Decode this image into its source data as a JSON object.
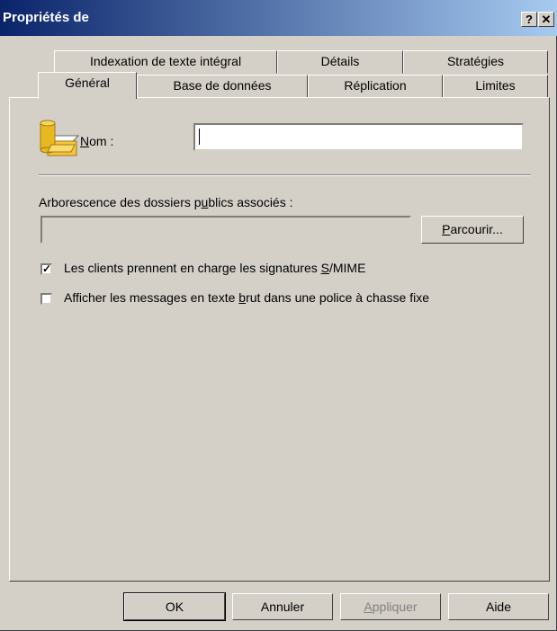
{
  "window": {
    "title": "Propriétés de"
  },
  "titlebar": {
    "help_glyph": "?",
    "close_glyph": "✕"
  },
  "tabs": {
    "row_back": [
      {
        "label": "Indexation de texte intégral"
      },
      {
        "label": "Détails"
      },
      {
        "label": "Stratégies"
      }
    ],
    "row_front": [
      {
        "label": "Général",
        "active": true
      },
      {
        "label": "Base de données"
      },
      {
        "label": "Réplication"
      },
      {
        "label": "Limites"
      }
    ]
  },
  "general": {
    "icon": "database-folder-icon",
    "name_label_mnemonic": "N",
    "name_label_rest": "om :",
    "name_value": "",
    "tree_label_pre": "Arborescence des dossiers p",
    "tree_label_mnemonic": "u",
    "tree_label_post": "blics associés :",
    "tree_value": "",
    "browse_mnemonic": "P",
    "browse_rest": "arcourir...",
    "check1": {
      "checked": true,
      "pre": "Les clients prennent en charge les signatures ",
      "mnemonic": "S",
      "post": "/MIME"
    },
    "check2": {
      "checked": false,
      "pre": "Afficher les messages en texte ",
      "mnemonic": "b",
      "post": "rut dans une police à chasse fixe"
    }
  },
  "footer": {
    "ok": "OK",
    "cancel": "Annuler",
    "apply_mnemonic": "A",
    "apply_rest": "ppliquer",
    "help": "Aide"
  },
  "colors": {
    "dialog_bg": "#d4d0c8",
    "title_start": "#0a246a",
    "title_end": "#a6caf0"
  }
}
